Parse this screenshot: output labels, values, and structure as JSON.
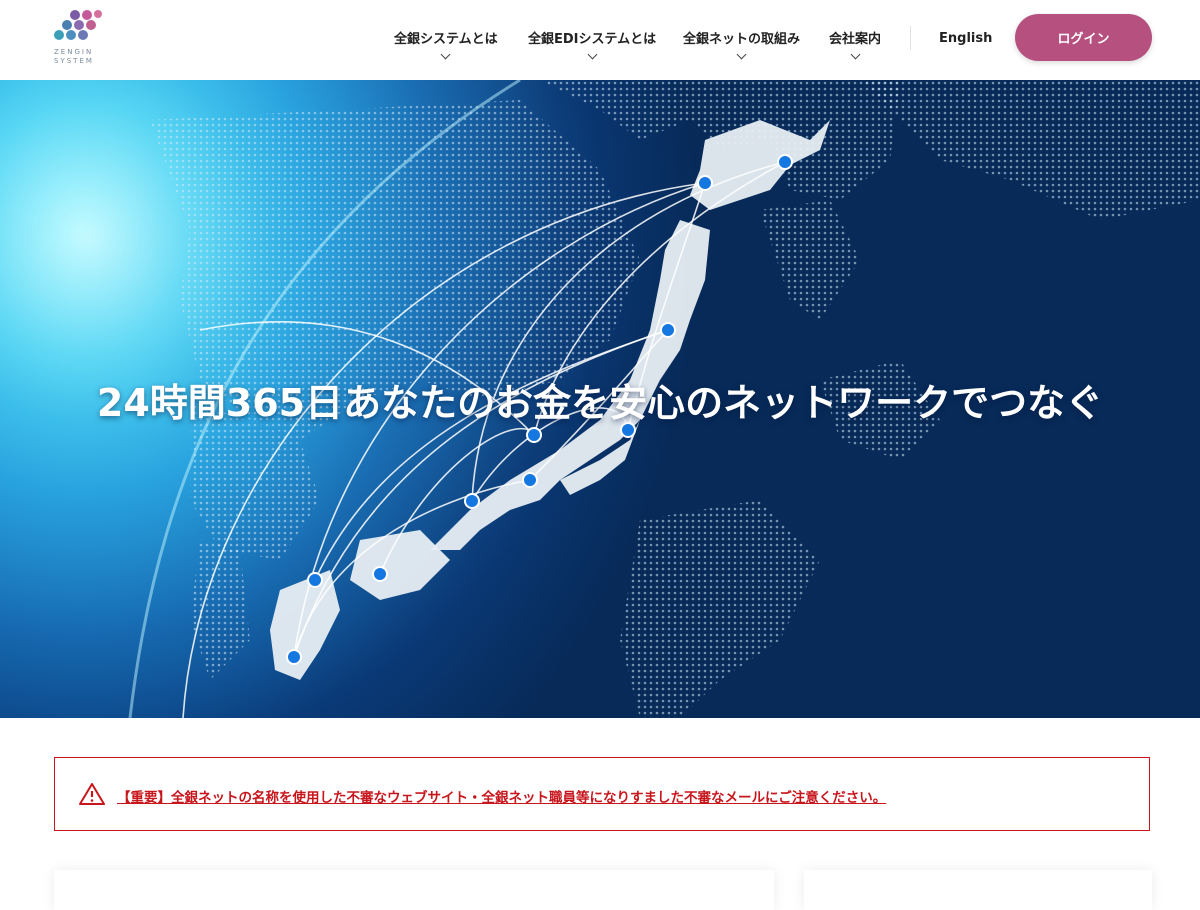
{
  "logo": {
    "text_line1": "ZENGIN",
    "text_line2": "SYSTEM"
  },
  "nav": {
    "items": [
      {
        "label": "全銀システムとは"
      },
      {
        "label": "全銀EDIシステムとは"
      },
      {
        "label": "全銀ネットの取組み"
      },
      {
        "label": "会社案内"
      }
    ],
    "english": "English",
    "login": "ログイン"
  },
  "hero": {
    "title": "24時間365日あなたのお金を安心のネットワークでつなぐ"
  },
  "alert": {
    "text": "【重要】全銀ネットの名称を使用した不審なウェブサイト・全銀ネット職員等になりすました不審なメールにご注意ください。"
  },
  "colors": {
    "login": "#b5507f",
    "alert": "#c8161d",
    "hero_deep": "#072a58",
    "hero_light": "#7ff5ff"
  }
}
